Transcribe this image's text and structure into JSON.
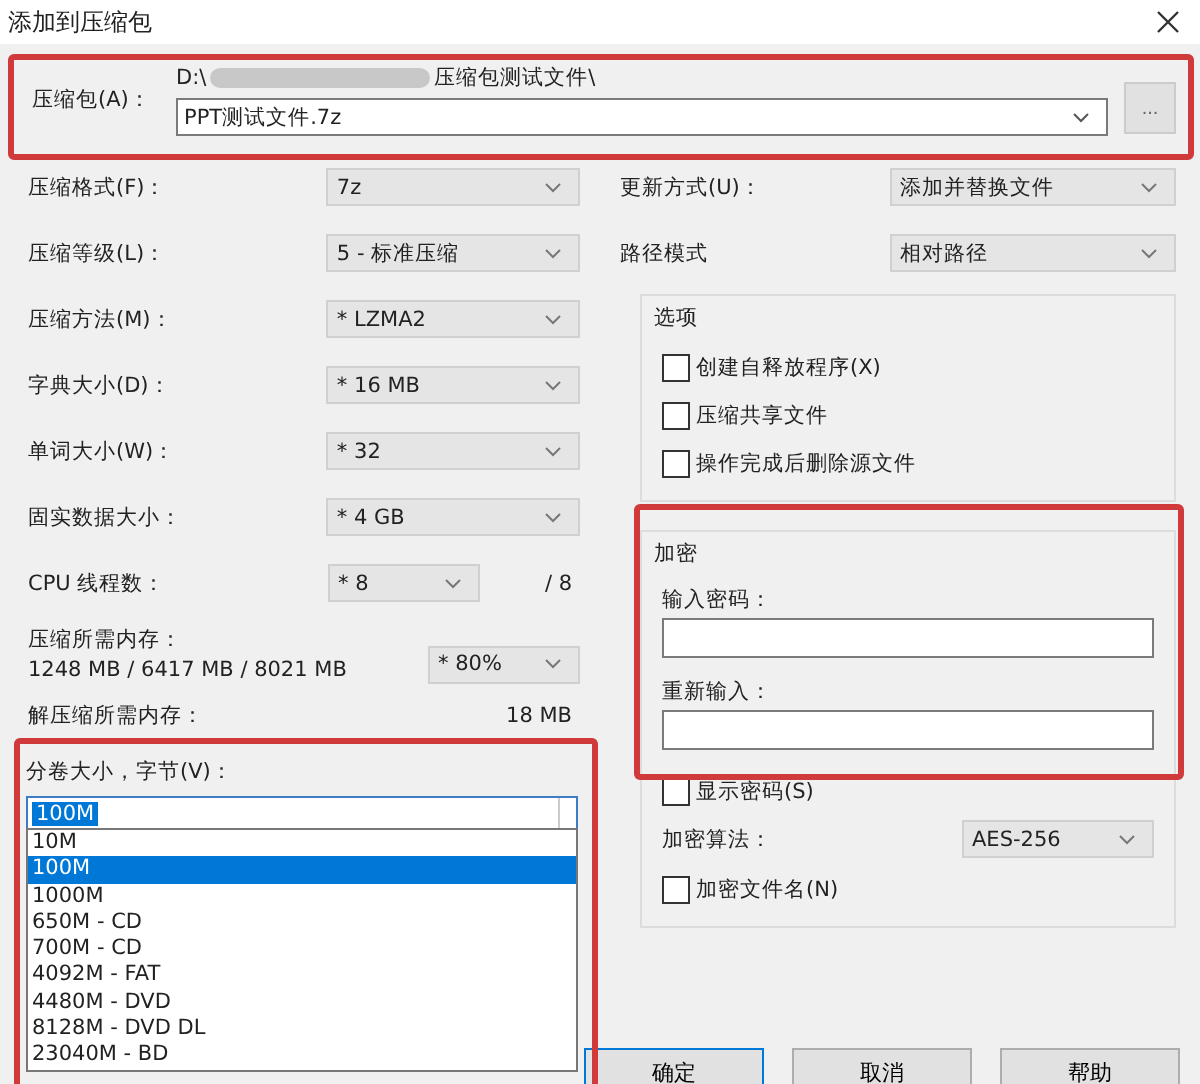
{
  "window": {
    "title": "添加到压缩包"
  },
  "archive": {
    "label": "压缩包(A)：",
    "path_start": "D:\\",
    "path_end": "压缩包测试文件\\",
    "value": "PPT测试文件.7z",
    "browse": "..."
  },
  "settings": [
    {
      "kind": "select",
      "label": "压缩格式(F)：",
      "value": "7z"
    },
    {
      "kind": "select",
      "label": "压缩等级(L)：",
      "value": "5 - 标准压缩"
    },
    {
      "kind": "select",
      "label": "压缩方法(M)：",
      "value": "* LZMA2"
    },
    {
      "kind": "select",
      "label": "字典大小(D)：",
      "value": "* 16 MB"
    },
    {
      "kind": "select",
      "label": "单词大小(W)：",
      "value": "* 32"
    },
    {
      "kind": "select",
      "label": "固实数据大小：",
      "value": "* 4 GB"
    },
    {
      "kind": "short",
      "label": "CPU 线程数：",
      "value": "* 8",
      "suffix": "/ 8"
    },
    {
      "kind": "memory",
      "label": "压缩所需内存：",
      "detail": "1248 MB / 6417 MB / 8021 MB",
      "value": "* 80%"
    },
    {
      "kind": "reading",
      "label": "解压缩所需内存：",
      "value": "18 MB"
    }
  ],
  "volume": {
    "label": "分卷大小，字节(V)：",
    "value": "100M",
    "options": [
      {
        "label": "10M",
        "selected": false
      },
      {
        "label": "100M",
        "selected": true
      },
      {
        "label": "1000M",
        "selected": false
      },
      {
        "label": "650M - CD",
        "selected": false
      },
      {
        "label": "700M - CD",
        "selected": false
      },
      {
        "label": "4092M - FAT",
        "selected": false
      },
      {
        "label": "4480M - DVD",
        "selected": false
      },
      {
        "label": "8128M - DVD DL",
        "selected": false
      },
      {
        "label": "23040M - BD",
        "selected": false
      }
    ]
  },
  "update": {
    "label": "更新方式(U)：",
    "value": "添加并替换文件"
  },
  "path_mode": {
    "label": "路径模式",
    "value": "相对路径"
  },
  "options": {
    "title": "选项",
    "items": [
      {
        "label": "创建自释放程序(X)",
        "checked": false
      },
      {
        "label": "压缩共享文件",
        "checked": false
      },
      {
        "label": "操作完成后删除源文件",
        "checked": false
      }
    ]
  },
  "encryption": {
    "title": "加密",
    "password_label": "输入密码：",
    "reenter_label": "重新输入：",
    "show_password": {
      "label": "显示密码(S)",
      "checked": false
    },
    "method_label": "加密算法：",
    "method": "AES-256",
    "encrypt_names": {
      "label": "加密文件名(N)",
      "checked": false
    }
  },
  "buttons": [
    {
      "label": "确定",
      "kind": "default"
    },
    {
      "label": "取消",
      "kind": "normal"
    },
    {
      "label": "帮助",
      "kind": "normal"
    }
  ]
}
